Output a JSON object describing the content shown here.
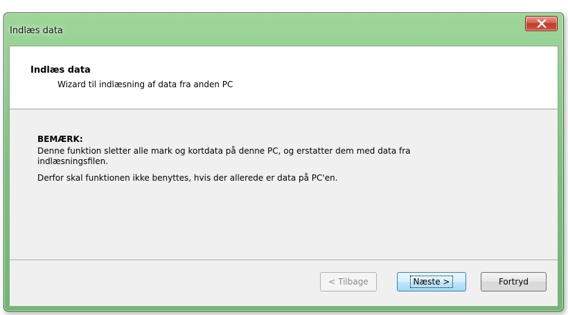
{
  "window": {
    "title": "Indlæs data"
  },
  "header": {
    "title": "Indlæs data",
    "subtitle": "Wizard til indlæsning af data fra anden PC"
  },
  "notice": {
    "title": "BEMÆRK:",
    "line1": "Denne funktion sletter alle mark og kortdata på denne PC, og erstatter dem med data fra indlæsningsfilen.",
    "line2": "Derfor skal funktionen ikke benyttes, hvis der allerede er data på PC'en."
  },
  "buttons": {
    "back": "< Tilbage",
    "next": "Næste >",
    "cancel": "Fortryd"
  },
  "icons": {
    "close": "close-icon"
  },
  "colors": {
    "titlebar_accent": "#79c079",
    "close_button": "#c0392b",
    "focus_button": "#bee6fd"
  }
}
